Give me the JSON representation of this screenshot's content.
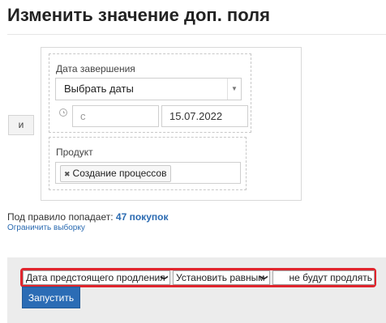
{
  "page": {
    "title": "Изменить значение доп. поля"
  },
  "conditions": {
    "join_label": "и",
    "date_block": {
      "label": "Дата завершения",
      "select_value": "Выбрать даты",
      "from_placeholder": "с",
      "to_value": "15.07.2022"
    },
    "product_block": {
      "label": "Продукт",
      "tags": [
        "Создание процессов"
      ]
    }
  },
  "summary": {
    "text": "Под правило попадает:",
    "count": "47 покупок",
    "limit_link": "Ограничить выборку"
  },
  "action": {
    "field_select": "Дата предстоящего продления",
    "operator_select": "Установить равным",
    "value": "не будут продлять",
    "run_label": "Запустить",
    "highlight_color": "#e0252d",
    "button_color": "#2b6cb5"
  }
}
